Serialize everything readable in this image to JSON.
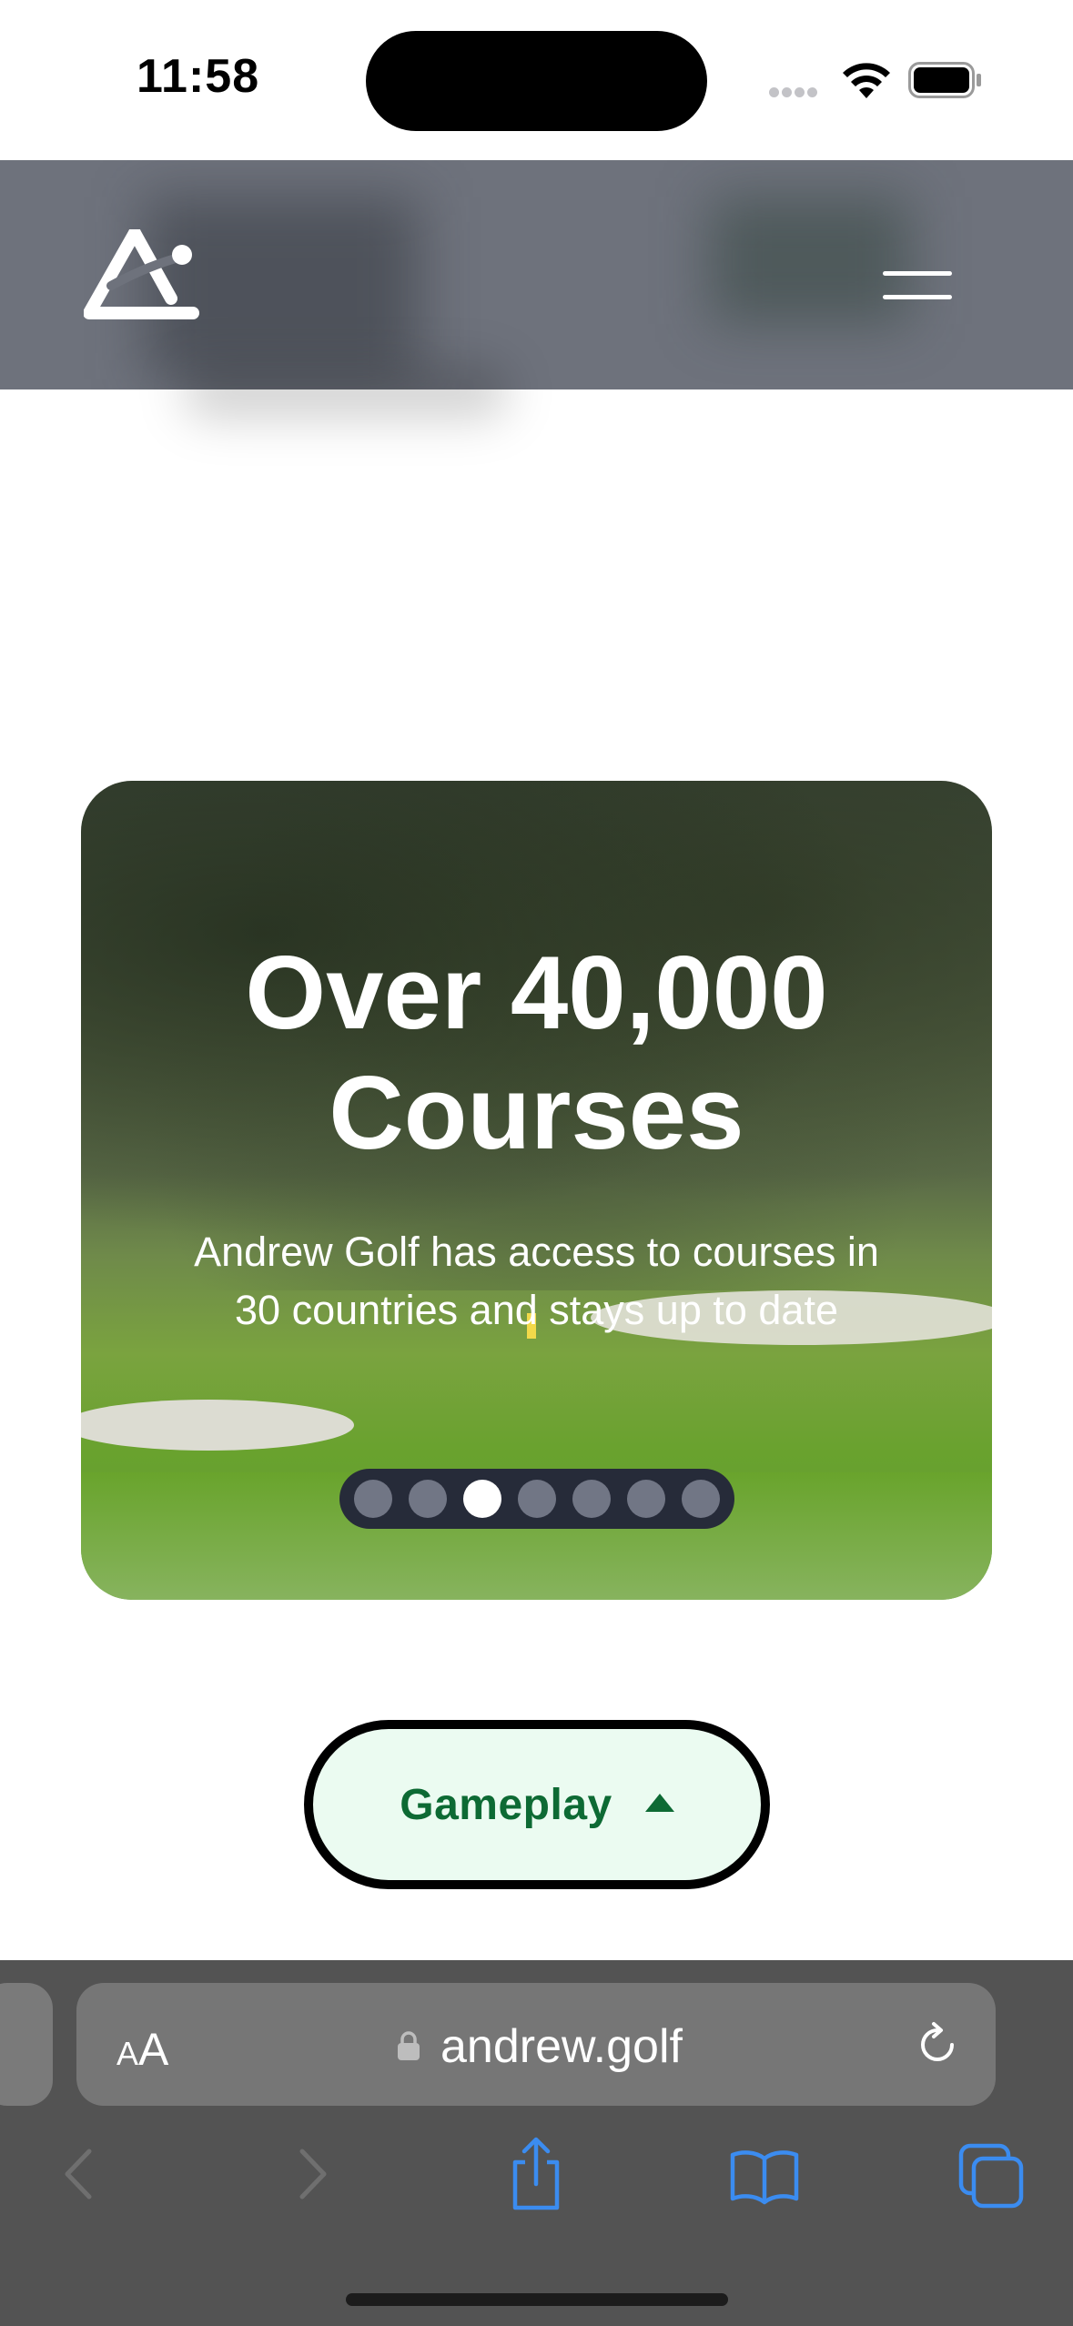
{
  "status_bar": {
    "time": "11:58"
  },
  "site": {
    "logo_icon": "andrew-golf-logo",
    "menu_icon": "hamburger-menu-icon"
  },
  "hero": {
    "title_line1": "Over 40,000",
    "title_line2": "Courses",
    "subtitle_line1": "Andrew Golf has access to courses in",
    "subtitle_line2": "30 countries and stays up to date",
    "carousel": {
      "count": 7,
      "active_index": 2
    }
  },
  "gameplay_button": {
    "label": "Gameplay",
    "icon": "caret-up-icon",
    "colors": {
      "background": "#ebfbf1",
      "text": "#0d6a34",
      "border": "#000000"
    }
  },
  "browser": {
    "text_size_small": "A",
    "text_size_large": "A",
    "url": "andrew.golf",
    "toolbar": [
      "back-icon",
      "forward-icon",
      "share-icon",
      "bookmarks-icon",
      "tabs-icon"
    ],
    "accent": "#3b8cf0"
  }
}
